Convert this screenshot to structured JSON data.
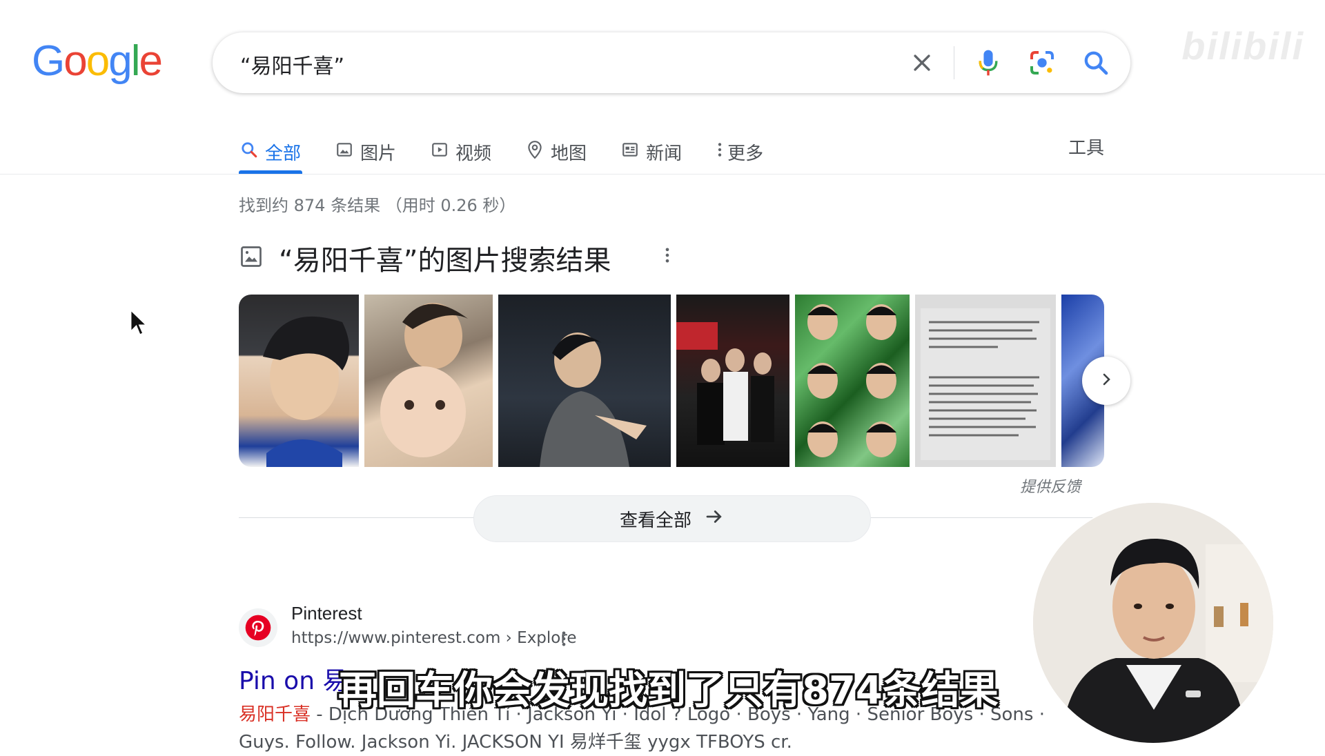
{
  "logo": {
    "text": "Google",
    "letters": [
      "G",
      "o",
      "o",
      "g",
      "l",
      "e"
    ],
    "colors": [
      "#4285F4",
      "#EA4335",
      "#FBBC05",
      "#4285F4",
      "#34A853",
      "#EA4335"
    ]
  },
  "search": {
    "query": "“易阳千喜”"
  },
  "watermark": "bilibili",
  "tabs": [
    {
      "label": "全部",
      "icon": "search-icon",
      "active": true
    },
    {
      "label": "图片",
      "icon": "image-icon"
    },
    {
      "label": "视频",
      "icon": "video-icon"
    },
    {
      "label": "地图",
      "icon": "map-pin-icon"
    },
    {
      "label": "新闻",
      "icon": "news-icon"
    },
    {
      "label": "更多",
      "icon": "more-vertical-icon"
    }
  ],
  "tools_label": "工具",
  "stats": "找到约 874 条结果 （用时 0.26 秒）",
  "images_section": {
    "title": "“易阳千喜”的图片搜索结果",
    "feedback": "提供反馈",
    "view_all": "查看全部"
  },
  "result": {
    "site_name": "Pinterest",
    "url": "https://www.pinterest.com › Explore",
    "title": "Pin on 易",
    "snippet_highlight": "易阳千喜",
    "snippet_line1": " - Dịch Dương Thiên Tỉ · Jackson Yi · Idol ? Logo · Boys · Yang · Senior Boys · Sons ·",
    "snippet_line2": "Guys. Follow. Jackson Yi. JACKSON YI 易烊千玺 yygx TFBOYS cr."
  },
  "subtitle": "再回车你会发现找到了只有874条结果",
  "colors": {
    "accent": "#1a73e8",
    "link": "#1a0dab",
    "highlight": "#d93025",
    "pinterest": "#e60023"
  }
}
